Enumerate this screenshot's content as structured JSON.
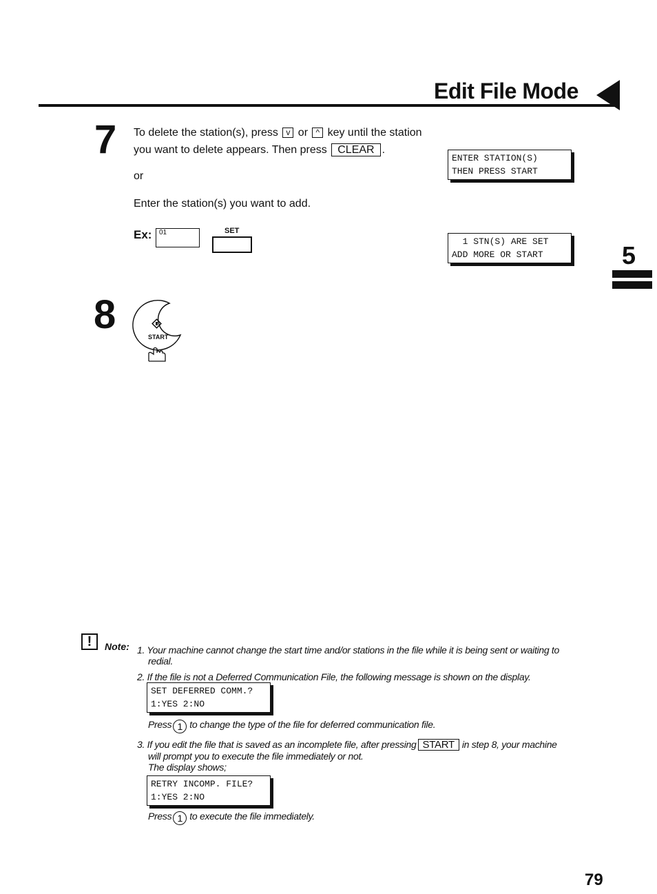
{
  "header": {
    "title": "Edit File Mode"
  },
  "chapter_tab": {
    "number": "5"
  },
  "step7": {
    "number": "7",
    "line1_a": "To delete the station(s), press",
    "key_down": "v",
    "line1_or": "or",
    "key_up": "^",
    "line1_b": "key until the station",
    "line2_a": "you want to delete appears.  Then press",
    "key_clear": "CLEAR",
    "line2_end": ".",
    "or_text": "or",
    "enter_text": "Enter the station(s) you want to add.",
    "example": {
      "label": "Ex:",
      "input_value": "01",
      "set_label": "SET"
    },
    "display1": {
      "line1": "ENTER STATION(S)",
      "line2": "THEN PRESS START"
    },
    "display2": {
      "line1": "  1 STN(S) ARE SET",
      "line2": "ADD MORE OR START"
    }
  },
  "step8": {
    "number": "8",
    "button_label": "START"
  },
  "note": {
    "label": "Note:",
    "items": [
      {
        "num": "1.",
        "text": "Your machine cannot change the start time and/or stations in the file while it is being sent or waiting to",
        "text_cont": "redial."
      },
      {
        "num": "2.",
        "text": "If the file is not a Deferred Communication File, the following message is shown on the display.",
        "display": {
          "line1": "SET DEFERRED COMM.?",
          "line2": "1:YES 2:NO"
        },
        "press_prefix": "Press",
        "press_key": "1",
        "press_suffix": "to change the type of the file for deferred communication file."
      },
      {
        "num": "3.",
        "text_a": "If you edit the file that is saved as an incomplete file, after pressing",
        "key": "START",
        "text_b": "in step 8, your machine",
        "text_cont": "will prompt you to execute the file immediately or not.",
        "text_shows": "The display shows;",
        "display": {
          "line1": "RETRY INCOMP. FILE?",
          "line2": "1:YES 2:NO"
        },
        "press_prefix": "Press",
        "press_key": "1",
        "press_suffix": "to execute the file immediately."
      }
    ]
  },
  "page_number": "79"
}
